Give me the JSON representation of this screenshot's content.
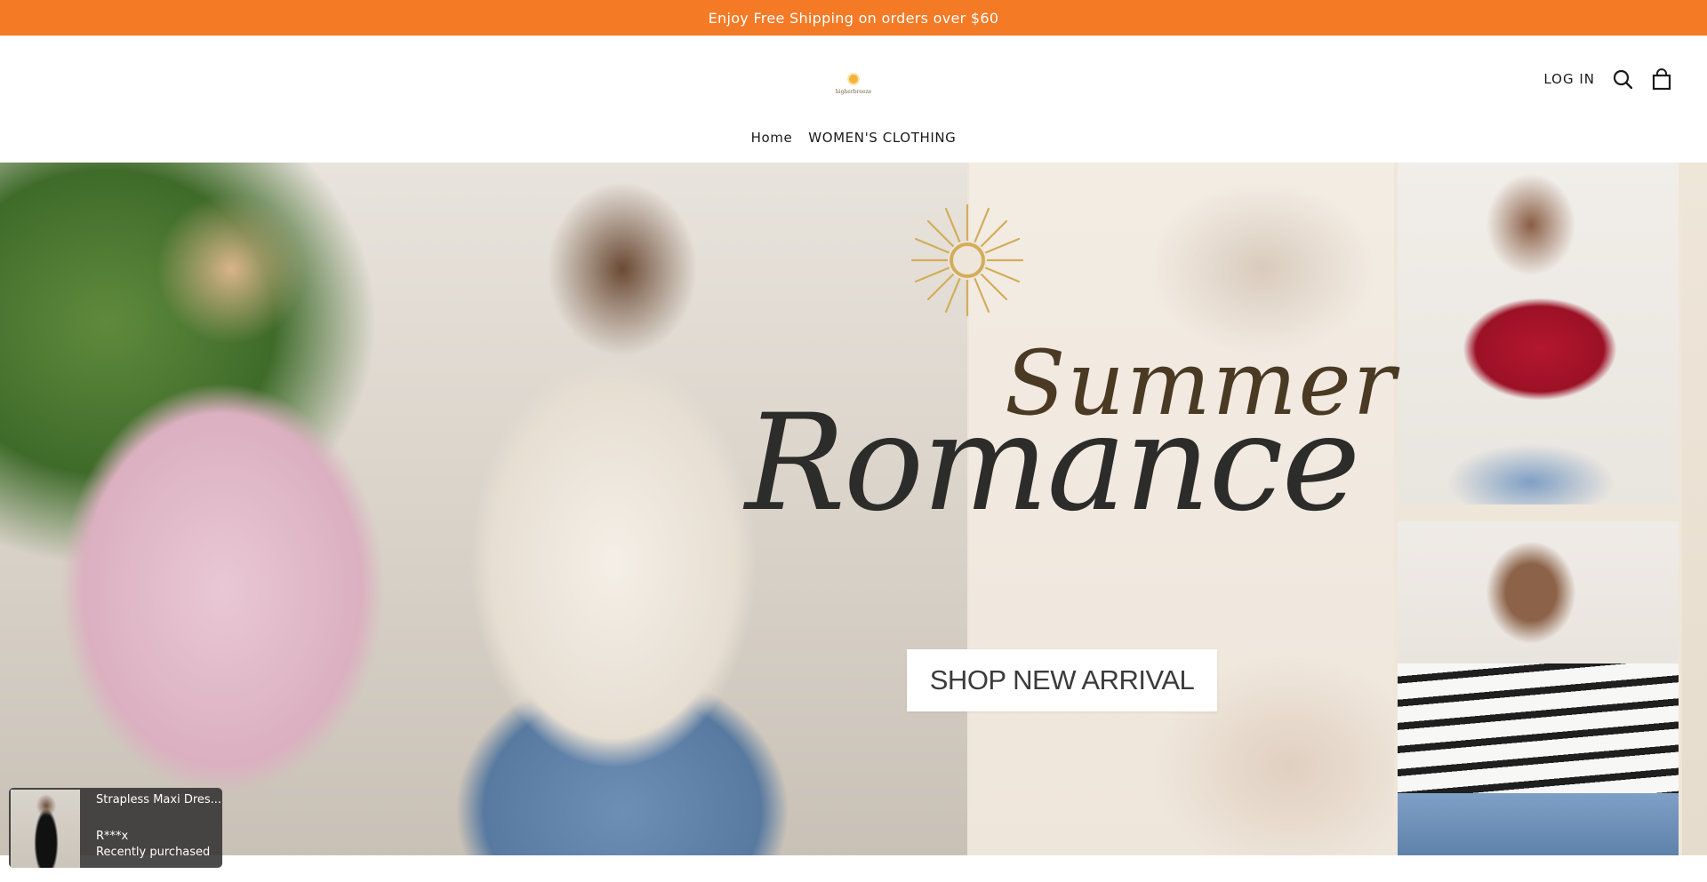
{
  "announcement": {
    "text": "Enjoy Free Shipping on orders over $60"
  },
  "header": {
    "logo_text": "higherbreeze",
    "login_label": "LOG IN",
    "search_icon": "search-icon",
    "cart_icon": "shopping-bag-icon"
  },
  "nav": {
    "items": [
      {
        "label": "Home"
      },
      {
        "label": "WOMEN'S CLOTHING"
      }
    ]
  },
  "hero": {
    "headline_top": "Summer",
    "headline_main": "Romance",
    "cta_label": "SHOP NEW ARRIVAL"
  },
  "purchase_popup": {
    "product": "Strapless Maxi Dres...",
    "buyer": "R***x",
    "status": "Recently purchased"
  },
  "colors": {
    "announcement_bg": "#f47a26",
    "text": "#1a1a1a",
    "popup_bg": "#323232"
  }
}
